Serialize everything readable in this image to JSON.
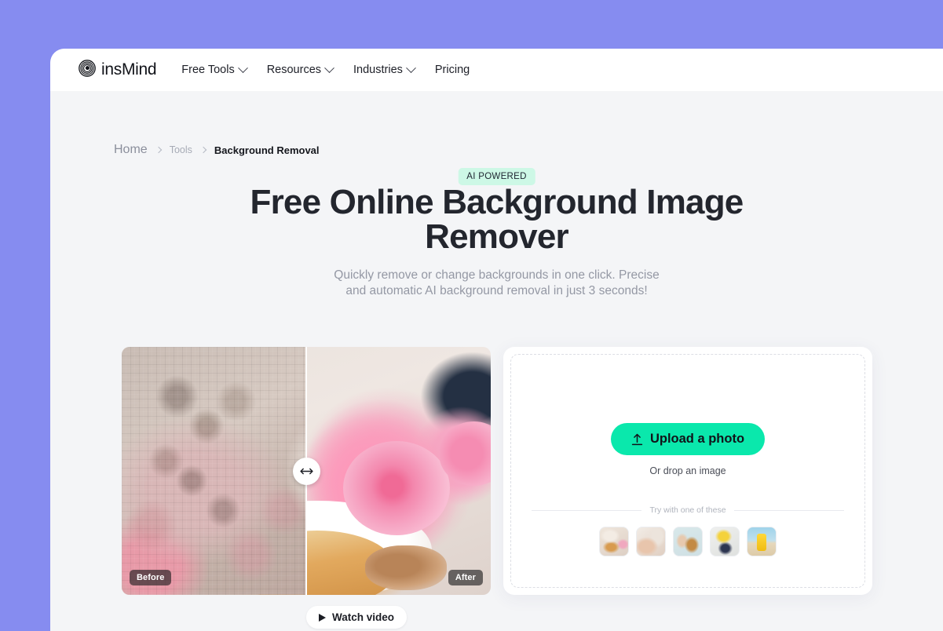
{
  "nav": {
    "brand": "insMind",
    "brand_icon": "concentric-circles-logo",
    "links": [
      {
        "label": "Free Tools",
        "has_dropdown": true
      },
      {
        "label": "Resources",
        "has_dropdown": true
      },
      {
        "label": "Industries",
        "has_dropdown": true
      },
      {
        "label": "Pricing",
        "has_dropdown": false
      }
    ]
  },
  "breadcrumb": {
    "home": "Home",
    "tools": "Tools",
    "current": "Background Removal"
  },
  "hero": {
    "badge": "AI POWERED",
    "headline": "Free Online Background Image Remover",
    "subhead": "Quickly remove or change backgrounds in one click. Precise and automatic AI background removal in just 3 seconds!"
  },
  "compare": {
    "before_label": "Before",
    "after_label": "After",
    "handle_icon": "left-right-arrow-icon",
    "slider_position_percent": 50
  },
  "watch_video": {
    "label": "Watch video",
    "icon": "play-icon"
  },
  "upload": {
    "button_label": "Upload a photo",
    "button_icon": "upload-arrow-icon",
    "drop_hint": "Or drop an image",
    "try_label": "Try with one of these",
    "samples": [
      {
        "name": "coffee-and-croissants"
      },
      {
        "name": "hand-with-ring"
      },
      {
        "name": "woman-with-dog"
      },
      {
        "name": "yellow-flowers-bouquet"
      },
      {
        "name": "yellow-bottle-on-beach"
      }
    ]
  },
  "colors": {
    "backdrop_purple": "#868cf0",
    "page_background": "#f4f5f7",
    "accent_green": "#0ae8ac",
    "badge_mint": "#cdf8e6",
    "heading_dark": "#23262e"
  }
}
